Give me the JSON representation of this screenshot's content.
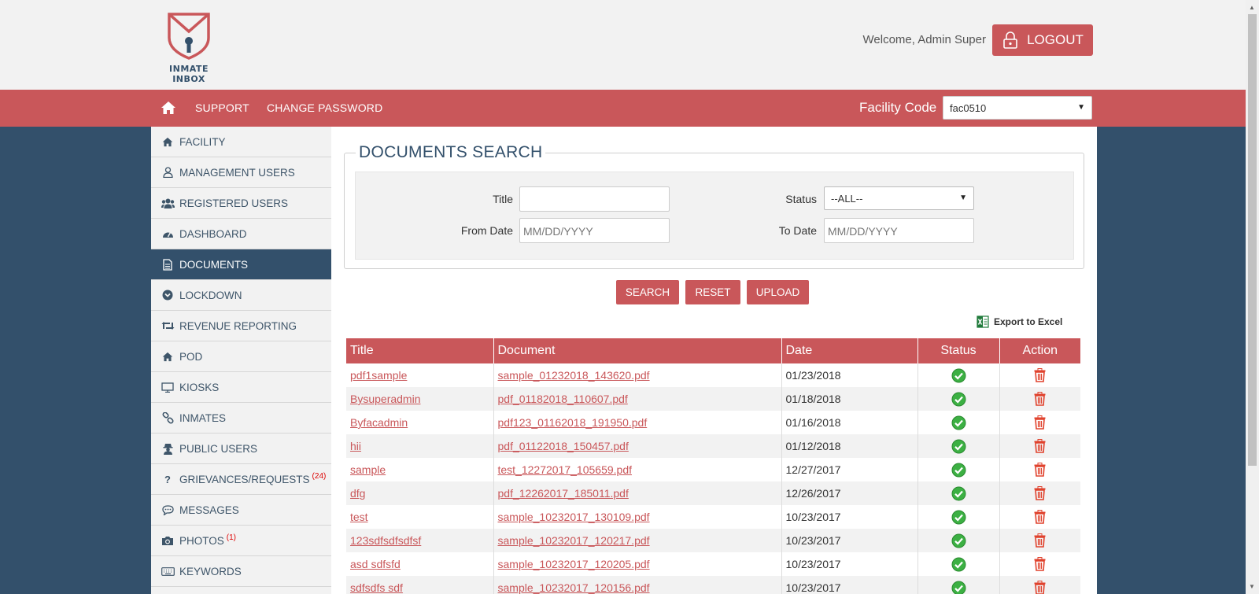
{
  "brand": {
    "name": "INMATE INBOX",
    "accent": "#c9575a",
    "navy": "#33506b"
  },
  "header": {
    "welcome": "Welcome, Admin Super",
    "logout_label": "LOGOUT"
  },
  "nav": {
    "links": [
      "SUPPORT",
      "CHANGE PASSWORD"
    ],
    "facility_label": "Facility Code",
    "facility_value": "fac0510"
  },
  "sidebar": {
    "items": [
      {
        "label": "FACILITY",
        "icon": "home-icon"
      },
      {
        "label": "MANAGEMENT USERS",
        "icon": "user-icon"
      },
      {
        "label": "REGISTERED USERS",
        "icon": "users-icon"
      },
      {
        "label": "DASHBOARD",
        "icon": "dashboard-icon"
      },
      {
        "label": "DOCUMENTS",
        "icon": "document-icon",
        "active": true
      },
      {
        "label": "LOCKDOWN",
        "icon": "chevron-circle-icon"
      },
      {
        "label": "REVENUE REPORTING",
        "icon": "retweet-icon"
      },
      {
        "label": "POD",
        "icon": "home-icon"
      },
      {
        "label": "KIOSKS",
        "icon": "monitor-icon"
      },
      {
        "label": "INMATES",
        "icon": "link-icon"
      },
      {
        "label": "PUBLIC USERS",
        "icon": "user-secret-icon"
      },
      {
        "label": "GRIEVANCES/REQUESTS",
        "icon": "question-icon",
        "badge": "(24)"
      },
      {
        "label": "MESSAGES",
        "icon": "comment-icon"
      },
      {
        "label": "PHOTOS",
        "icon": "camera-icon",
        "badge": "(1)"
      },
      {
        "label": "KEYWORDS",
        "icon": "keyboard-icon"
      }
    ]
  },
  "search": {
    "legend": "DOCUMENTS SEARCH",
    "title_label": "Title",
    "title_value": "",
    "status_label": "Status",
    "status_value": "--ALL--",
    "from_label": "From Date",
    "from_placeholder": "MM/DD/YYYY",
    "to_label": "To Date",
    "to_placeholder": "MM/DD/YYYY",
    "buttons": {
      "search": "SEARCH",
      "reset": "RESET",
      "upload": "UPLOAD"
    },
    "export_label": "Export to Excel"
  },
  "table": {
    "headers": [
      "Title",
      "Document",
      "Date",
      "Status",
      "Action"
    ],
    "rows": [
      {
        "title": "pdf1sample",
        "document": "sample_01232018_143620.pdf",
        "date": "01/23/2018"
      },
      {
        "title": "Bysuperadmin",
        "document": "pdf_01182018_110607.pdf",
        "date": "01/18/2018"
      },
      {
        "title": "Byfacadmin",
        "document": "pdf123_01162018_191950.pdf",
        "date": "01/16/2018"
      },
      {
        "title": "hii",
        "document": "pdf_01122018_150457.pdf",
        "date": "01/12/2018"
      },
      {
        "title": "sample",
        "document": "test_12272017_105659.pdf",
        "date": "12/27/2017"
      },
      {
        "title": "dfg",
        "document": "pdf_12262017_185011.pdf",
        "date": "12/26/2017"
      },
      {
        "title": "test",
        "document": "sample_10232017_130109.pdf",
        "date": "10/23/2017"
      },
      {
        "title": "123sdfsdfsdfsf",
        "document": "sample_10232017_120217.pdf",
        "date": "10/23/2017"
      },
      {
        "title": "asd sdfsfd",
        "document": "sample_10232017_120205.pdf",
        "date": "10/23/2017"
      },
      {
        "title": "sdfsdfs sdf",
        "document": "sample_10232017_120156.pdf",
        "date": "10/23/2017"
      }
    ]
  }
}
